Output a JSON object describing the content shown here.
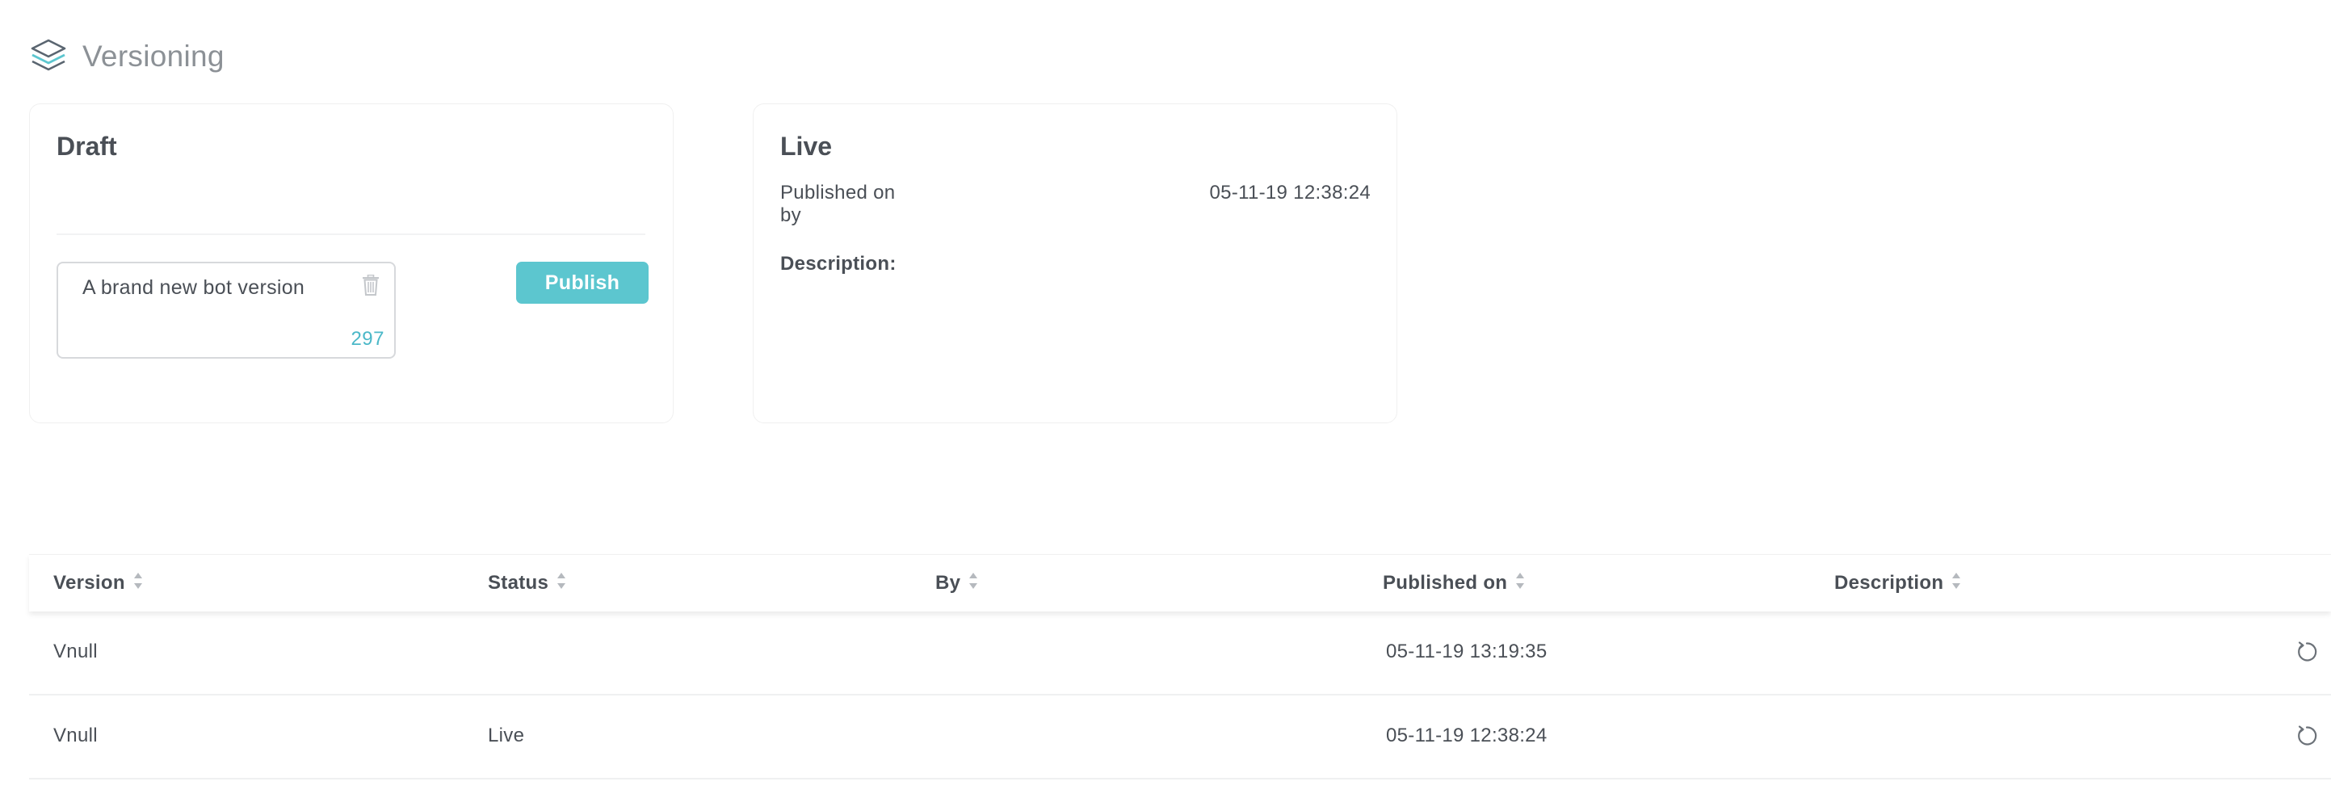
{
  "page": {
    "title": "Versioning",
    "icon": "layers-icon"
  },
  "draft": {
    "title": "Draft",
    "version_description_value": "A brand new bot version",
    "char_count": "297",
    "publish_label": "Publish"
  },
  "live": {
    "title": "Live",
    "published_on_label": "Published on",
    "by_label": "by",
    "published_on_value": "05-11-19 12:38:24",
    "description_label": "Description:"
  },
  "table": {
    "columns": [
      "Version",
      "Status",
      "By",
      "Published on",
      "Description"
    ],
    "rows": [
      {
        "version": "Vnull",
        "status": "",
        "by": "",
        "published_on": "05-11-19 13:19:35",
        "description": ""
      },
      {
        "version": "Vnull",
        "status": "Live",
        "by": "",
        "published_on": "05-11-19 12:38:24",
        "description": ""
      }
    ]
  },
  "colors": {
    "accent": "#5cc6cf",
    "char_count": "#4bb8c8"
  }
}
